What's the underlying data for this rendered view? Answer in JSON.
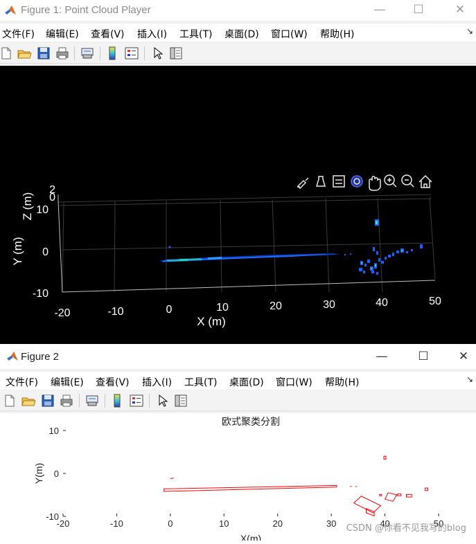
{
  "figure1": {
    "title": "Figure 1: Point Cloud Player",
    "menu": [
      "文件(F)",
      "编辑(E)",
      "查看(V)",
      "插入(I)",
      "工具(T)",
      "桌面(D)",
      "窗口(W)",
      "帮助(H)"
    ],
    "window_controls": {
      "minimize": "—",
      "maximize": "☐",
      "close": "✕"
    },
    "axis_toolbar": [
      "brush-icon",
      "data-tips-icon",
      "legend-icon",
      "rotate-3d-icon",
      "pan-icon",
      "zoom-in-icon",
      "zoom-out-icon",
      "home-icon"
    ],
    "xlabel": "X (m)",
    "ylabel": "Y (m)",
    "zlabel": "Z (m)",
    "x_ticks": [
      "-20",
      "-10",
      "0",
      "10",
      "20",
      "30",
      "40",
      "50"
    ],
    "y_ticks": [
      "10",
      "0",
      "-10"
    ],
    "z_ticks": [
      "2",
      "0"
    ],
    "background": "#000000",
    "point_color": "#1560ff",
    "point_accent": "#2ee8b0"
  },
  "figure2": {
    "title": "Figure 2",
    "menu": [
      "文件(F)",
      "编辑(E)",
      "查看(V)",
      "插入(I)",
      "工具(T)",
      "桌面(D)",
      "窗口(W)",
      "帮助(H)"
    ],
    "window_controls": {
      "minimize": "—",
      "maximize": "☐",
      "close": "✕"
    }
  },
  "chart_data": {
    "type": "bounding-boxes",
    "title": "欧式聚类分割",
    "xlabel": "X(m)",
    "ylabel": "Y(m)",
    "xlim": [
      -20,
      50
    ],
    "ylim": [
      -10,
      10
    ],
    "x_ticks": [
      -20,
      -10,
      0,
      10,
      20,
      30,
      40,
      50
    ],
    "y_ticks": [
      -10,
      0,
      10
    ],
    "box_color": "#ff0000",
    "boxes": [
      {
        "x": [
          -1.2,
          31,
          31,
          -1.2
        ],
        "y": [
          -3.6,
          -2.8,
          -3.2,
          -4.2
        ]
      },
      {
        "x": [
          0,
          0.6
        ],
        "y": [
          -1.3,
          -1.0
        ]
      },
      {
        "x": [
          39.8,
          40.2,
          40.2,
          39.8
        ],
        "y": [
          4.0,
          4.0,
          3.3,
          3.3
        ]
      },
      {
        "x": [
          34.2,
          37.8,
          39.2,
          35.6
        ],
        "y": [
          -6.9,
          -9.2,
          -7.5,
          -5.3
        ]
      },
      {
        "x": [
          36.5,
          38.0,
          38.0,
          36.5
        ],
        "y": [
          -9.2,
          -9.9,
          -8.9,
          -8.2
        ]
      },
      {
        "x": [
          40.0,
          41.5,
          42.2,
          40.6
        ],
        "y": [
          -6.0,
          -6.5,
          -5.0,
          -4.5
        ]
      },
      {
        "x": [
          39.0,
          39.4,
          39.4,
          39.0
        ],
        "y": [
          -5.2,
          -5.2,
          -4.9,
          -4.9
        ]
      },
      {
        "x": [
          42.3,
          43.0,
          43.0,
          42.3
        ],
        "y": [
          -5.2,
          -5.2,
          -4.8,
          -4.8
        ]
      },
      {
        "x": [
          44.0,
          45.0,
          45.0,
          44.0
        ],
        "y": [
          -5.5,
          -5.5,
          -4.9,
          -4.9
        ]
      },
      {
        "x": [
          47.5,
          48.0,
          48.0,
          47.5
        ],
        "y": [
          -4.0,
          -4.0,
          -3.4,
          -3.4
        ]
      },
      {
        "x": [
          33.5,
          33.8
        ],
        "y": [
          -3.1,
          -3.0
        ]
      },
      {
        "x": [
          34.5,
          34.8
        ],
        "y": [
          -3.1,
          -3.0
        ]
      }
    ]
  },
  "watermark": "CSDN @你看不见我写的blog"
}
